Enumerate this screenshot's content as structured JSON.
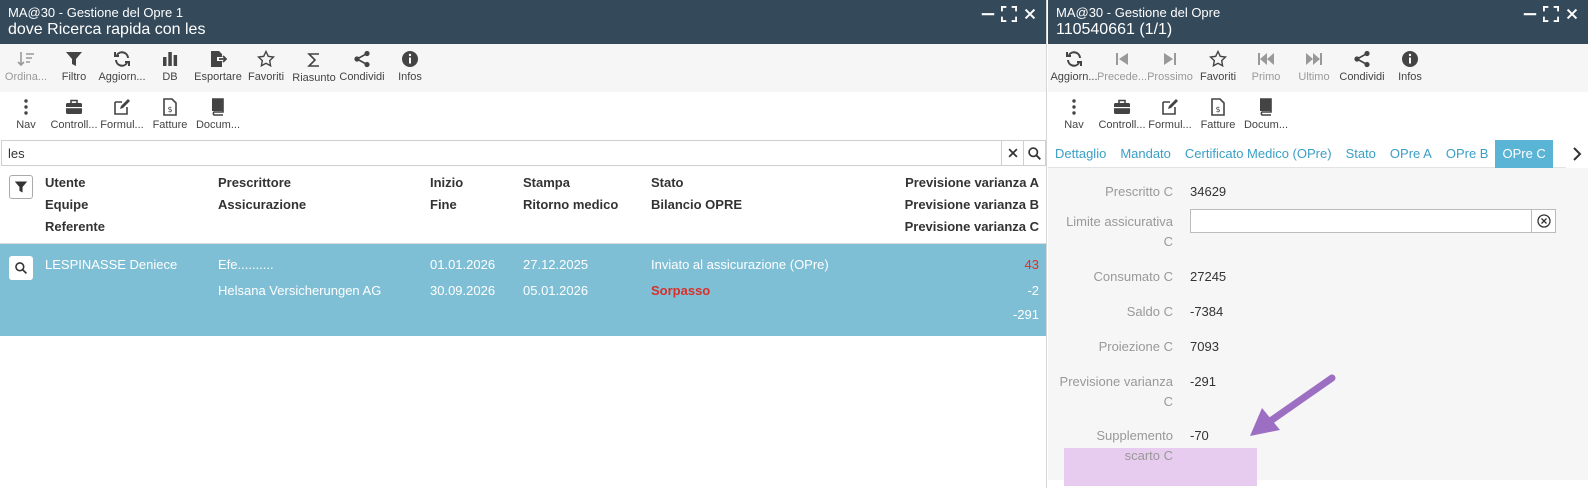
{
  "left": {
    "title_line1": "MA@30 - Gestione del Opre 1",
    "title_line2": "dove Ricerca rapida con les",
    "toolbar1": [
      {
        "label": "Ordina...",
        "icon": "sort-icon",
        "disabled": true
      },
      {
        "label": "Filtro",
        "icon": "filter-icon"
      },
      {
        "label": "Aggiorn...",
        "icon": "refresh-icon"
      },
      {
        "label": "DB",
        "icon": "bar-chart-icon"
      },
      {
        "label": "Esportare",
        "icon": "export-icon"
      },
      {
        "label": "Favoriti",
        "icon": "star-icon"
      },
      {
        "label": "Riasunto",
        "icon": "sigma-icon"
      },
      {
        "label": "Condividi",
        "icon": "share-icon"
      },
      {
        "label": "Infos",
        "icon": "info-icon"
      }
    ],
    "toolbar2": [
      {
        "label": "Nav",
        "icon": "more-vertical-icon"
      },
      {
        "label": "Controll...",
        "icon": "briefcase-icon"
      },
      {
        "label": "Formul...",
        "icon": "edit-icon"
      },
      {
        "label": "Fatture",
        "icon": "invoice-icon"
      },
      {
        "label": "Docum...",
        "icon": "book-icon"
      }
    ],
    "search_value": "les",
    "headers": {
      "c1": [
        "Utente",
        "Equipe",
        "Referente"
      ],
      "c2": [
        "Prescrittore",
        "Assicurazione"
      ],
      "c3": [
        "Inizio",
        "Fine"
      ],
      "c4": [
        "Stampa",
        "Ritorno medico"
      ],
      "c5": [
        "Stato",
        "Bilancio OPRE"
      ],
      "c6": [
        "Previsione varianza A",
        "Previsione varianza B",
        "Previsione varianza C"
      ]
    },
    "row": {
      "utente": "LESPINASSE Deniece",
      "prescrittore": "Efe..........",
      "assicurazione": "Helsana Versicherungen AG",
      "inizio": "01.01.2026",
      "fine": "30.09.2026",
      "stampa": "27.12.2025",
      "ritorno": "05.01.2026",
      "stato": "Inviato al assicurazione (OPre)",
      "bilancio": "Sorpasso",
      "var_a": "43",
      "var_b": "-2",
      "var_c": "-291"
    }
  },
  "right": {
    "title_line1": "MA@30 - Gestione del Opre",
    "title_line2": "110540661 (1/1)",
    "toolbar1": [
      {
        "label": "Aggiorn...",
        "icon": "refresh-icon"
      },
      {
        "label": "Precede...",
        "icon": "previous-icon",
        "disabled": true
      },
      {
        "label": "Prossimo",
        "icon": "next-icon",
        "disabled": true
      },
      {
        "label": "Favoriti",
        "icon": "star-icon"
      },
      {
        "label": "Primo",
        "icon": "first-icon",
        "disabled": true
      },
      {
        "label": "Ultimo",
        "icon": "last-icon",
        "disabled": true
      },
      {
        "label": "Condividi",
        "icon": "share-icon"
      },
      {
        "label": "Infos",
        "icon": "info-icon"
      }
    ],
    "toolbar2": [
      {
        "label": "Nav",
        "icon": "more-vertical-icon"
      },
      {
        "label": "Controll...",
        "icon": "briefcase-icon"
      },
      {
        "label": "Formul...",
        "icon": "edit-icon"
      },
      {
        "label": "Fatture",
        "icon": "invoice-icon"
      },
      {
        "label": "Docum...",
        "icon": "book-icon"
      }
    ],
    "tabs": [
      "Dettaglio",
      "Mandato",
      "Certificato Medico (OPre)",
      "Stato",
      "OPre A",
      "OPre B",
      "OPre C"
    ],
    "fields": {
      "prescritto_label": "Prescritto C",
      "prescritto_value": "34629",
      "limite_label_1": "Limite assicurativa",
      "limite_label_2": "C",
      "consumato_label": "Consumato C",
      "consumato_value": "27245",
      "saldo_label": "Saldo C",
      "saldo_value": "-7384",
      "proiezione_label": "Proiezione C",
      "proiezione_value": "7093",
      "prevvar_label_1": "Previsione varianza",
      "prevvar_label_2": "C",
      "prevvar_value": "-291",
      "suppl_label_1": "Supplemento",
      "suppl_label_2": "scarto C",
      "suppl_value": "-70"
    }
  },
  "colors": {
    "titlebar": "#34495a",
    "row_selected": "#7fbfd5",
    "tab_active": "#5ab4d6",
    "alert": "#d9302a",
    "highlight": "#e8ccf0",
    "arrow": "#9d6fc2"
  }
}
